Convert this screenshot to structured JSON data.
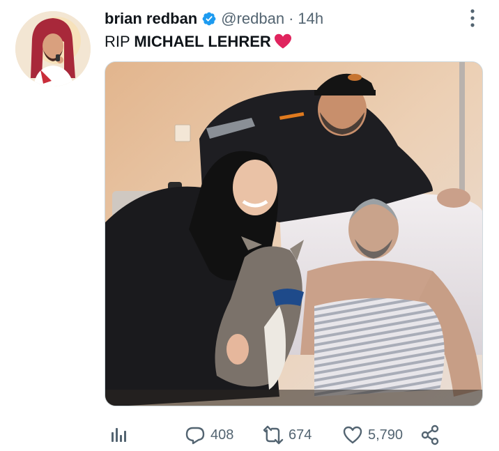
{
  "tweet": {
    "display_name": "brian redban",
    "handle": "@redban",
    "separator": "·",
    "time": "14h",
    "text_prefix": "RIP ",
    "text_strong": "MICHAEL LEHRER",
    "emoji": "red-heart",
    "photo_alt": ""
  },
  "actions": {
    "views_icon": "views-icon",
    "reply_count": "408",
    "retweet_count": "674",
    "like_count": "5,790",
    "share_icon": "share-icon"
  },
  "colors": {
    "text": "#0f1419",
    "secondary": "#536471",
    "verified": "#1d9bf0",
    "heart": "#e0245e",
    "border": "#cfd9de"
  }
}
